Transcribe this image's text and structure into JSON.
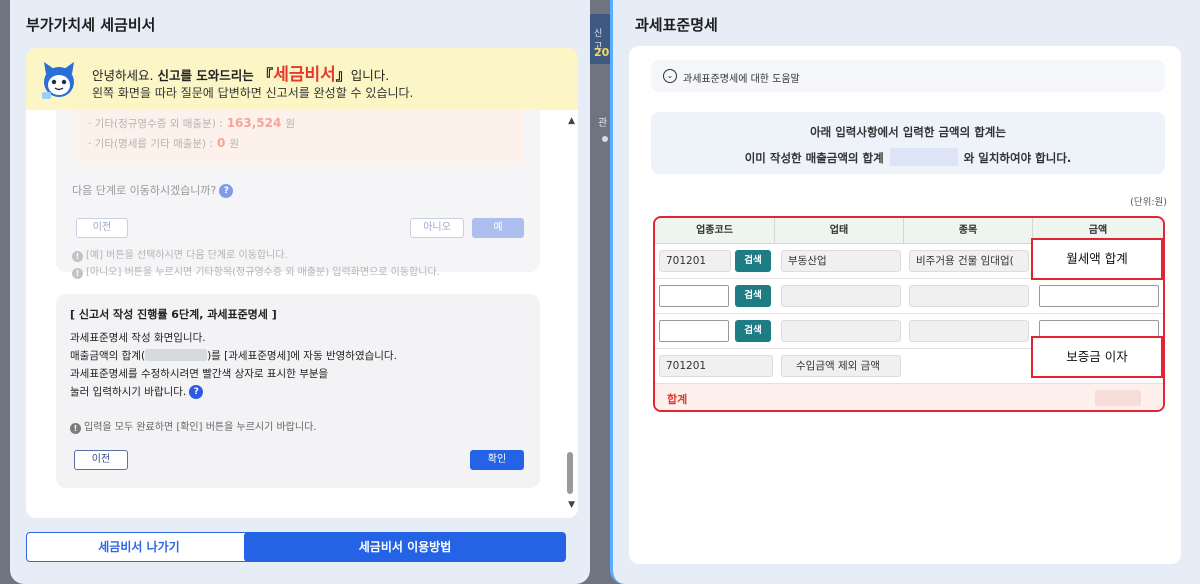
{
  "left": {
    "title": "부가가치세 세금비서",
    "banner": {
      "greeting": "안녕하세요. ",
      "intro_bold": "신고를 도와드리는 ",
      "bracket_open": "『",
      "brand": "세금비서",
      "bracket_close": "』",
      "suffix": "입니다.",
      "line2": "왼쪽 화면을 따라 질문에 답변하면 신고서를 완성할 수 있습니다."
    },
    "prev_bubble": {
      "amount_rows": [
        {
          "label": "· 기타(정규영수증 외 매출분) :",
          "value": "163,524",
          "unit": "원"
        },
        {
          "label": "· 기타(명세를 기타 매출분) :",
          "value": "0",
          "unit": "원"
        }
      ],
      "question": "다음 단계로 이동하시겠습니까?",
      "btn_prev": "이전",
      "btn_no": "아니오",
      "btn_yes": "예",
      "note1": "[예] 버튼을 선택하시면 다음 단계로 이동합니다.",
      "note2": "[아니오] 버튼을 누르시면 기타항목(정규영수증 외 매출분) 입력화면으로 이동합니다."
    },
    "step_bubble": {
      "title": "[ 신고서 작성 진행률 6단계, 과세표준명세 ]",
      "line1": "과세표준명세 작성 화면입니다.",
      "line2_a": "매출금액의 합계(",
      "line2_b": ")를 [과세표준명세]에 자동 반영하였습니다.",
      "line3": "과세표준명세를 수정하시려면 빨간색 상자로 표시한 부분을",
      "line4": "눌러 입력하시기 바랍니다.",
      "note": "입력을 모두 완료하면 [확인] 버튼을 누르시기 바랍니다.",
      "btn_prev": "이전",
      "btn_confirm": "확인"
    },
    "exit_button": "세금비서 나가기",
    "howto_button": "세금비서 이용방법"
  },
  "sliver": {
    "text1": "신고",
    "text2": "20",
    "text3": "관"
  },
  "right": {
    "title": "과세표준명세",
    "accordion_label": "과세표준명세에 대한 도움말",
    "notice_line1": "아래 입력사항에서 입력한 금액의 합계는",
    "notice_line2_a": "이미 작성한 매출금액의 합계",
    "notice_line2_b": "와 일치하여야 합니다.",
    "unit": "(단위:원)",
    "table": {
      "headers": [
        "업종코드",
        "업태",
        "종목",
        "금액"
      ],
      "search_label": "검색",
      "row1": {
        "code": "701201",
        "biz_type": "부동산업",
        "item": "비주거용 건물 임대업("
      },
      "row4": {
        "code": "701201",
        "biz_type": "수입금액 제외 금액"
      },
      "total_label": "합계"
    },
    "callout_top": "월세액 합계",
    "callout_bottom": "보증금 이자"
  }
}
